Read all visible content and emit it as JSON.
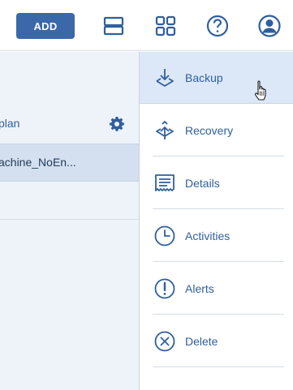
{
  "toolbar": {
    "add_label": "ADD",
    "icons": [
      "rows-view-icon",
      "grid-view-icon",
      "help-icon",
      "account-icon"
    ]
  },
  "left_pane": {
    "plan_label": "plan",
    "machine_label": "achine_NoEn..."
  },
  "actions": [
    {
      "label": "Backup",
      "icon": "backup-icon",
      "active": true
    },
    {
      "label": "Recovery",
      "icon": "recovery-icon",
      "active": false
    },
    {
      "label": "Details",
      "icon": "details-icon",
      "active": false
    },
    {
      "label": "Activities",
      "icon": "activities-clock-icon",
      "active": false
    },
    {
      "label": "Alerts",
      "icon": "alerts-icon",
      "active": false
    },
    {
      "label": "Delete",
      "icon": "delete-icon",
      "active": false
    }
  ],
  "colors": {
    "accent": "#3b68a8",
    "icon": "#2f5f9e",
    "selected_row": "#d4e0ef",
    "active_action": "#dce8f8",
    "left_pane_bg": "#eef3fa"
  }
}
